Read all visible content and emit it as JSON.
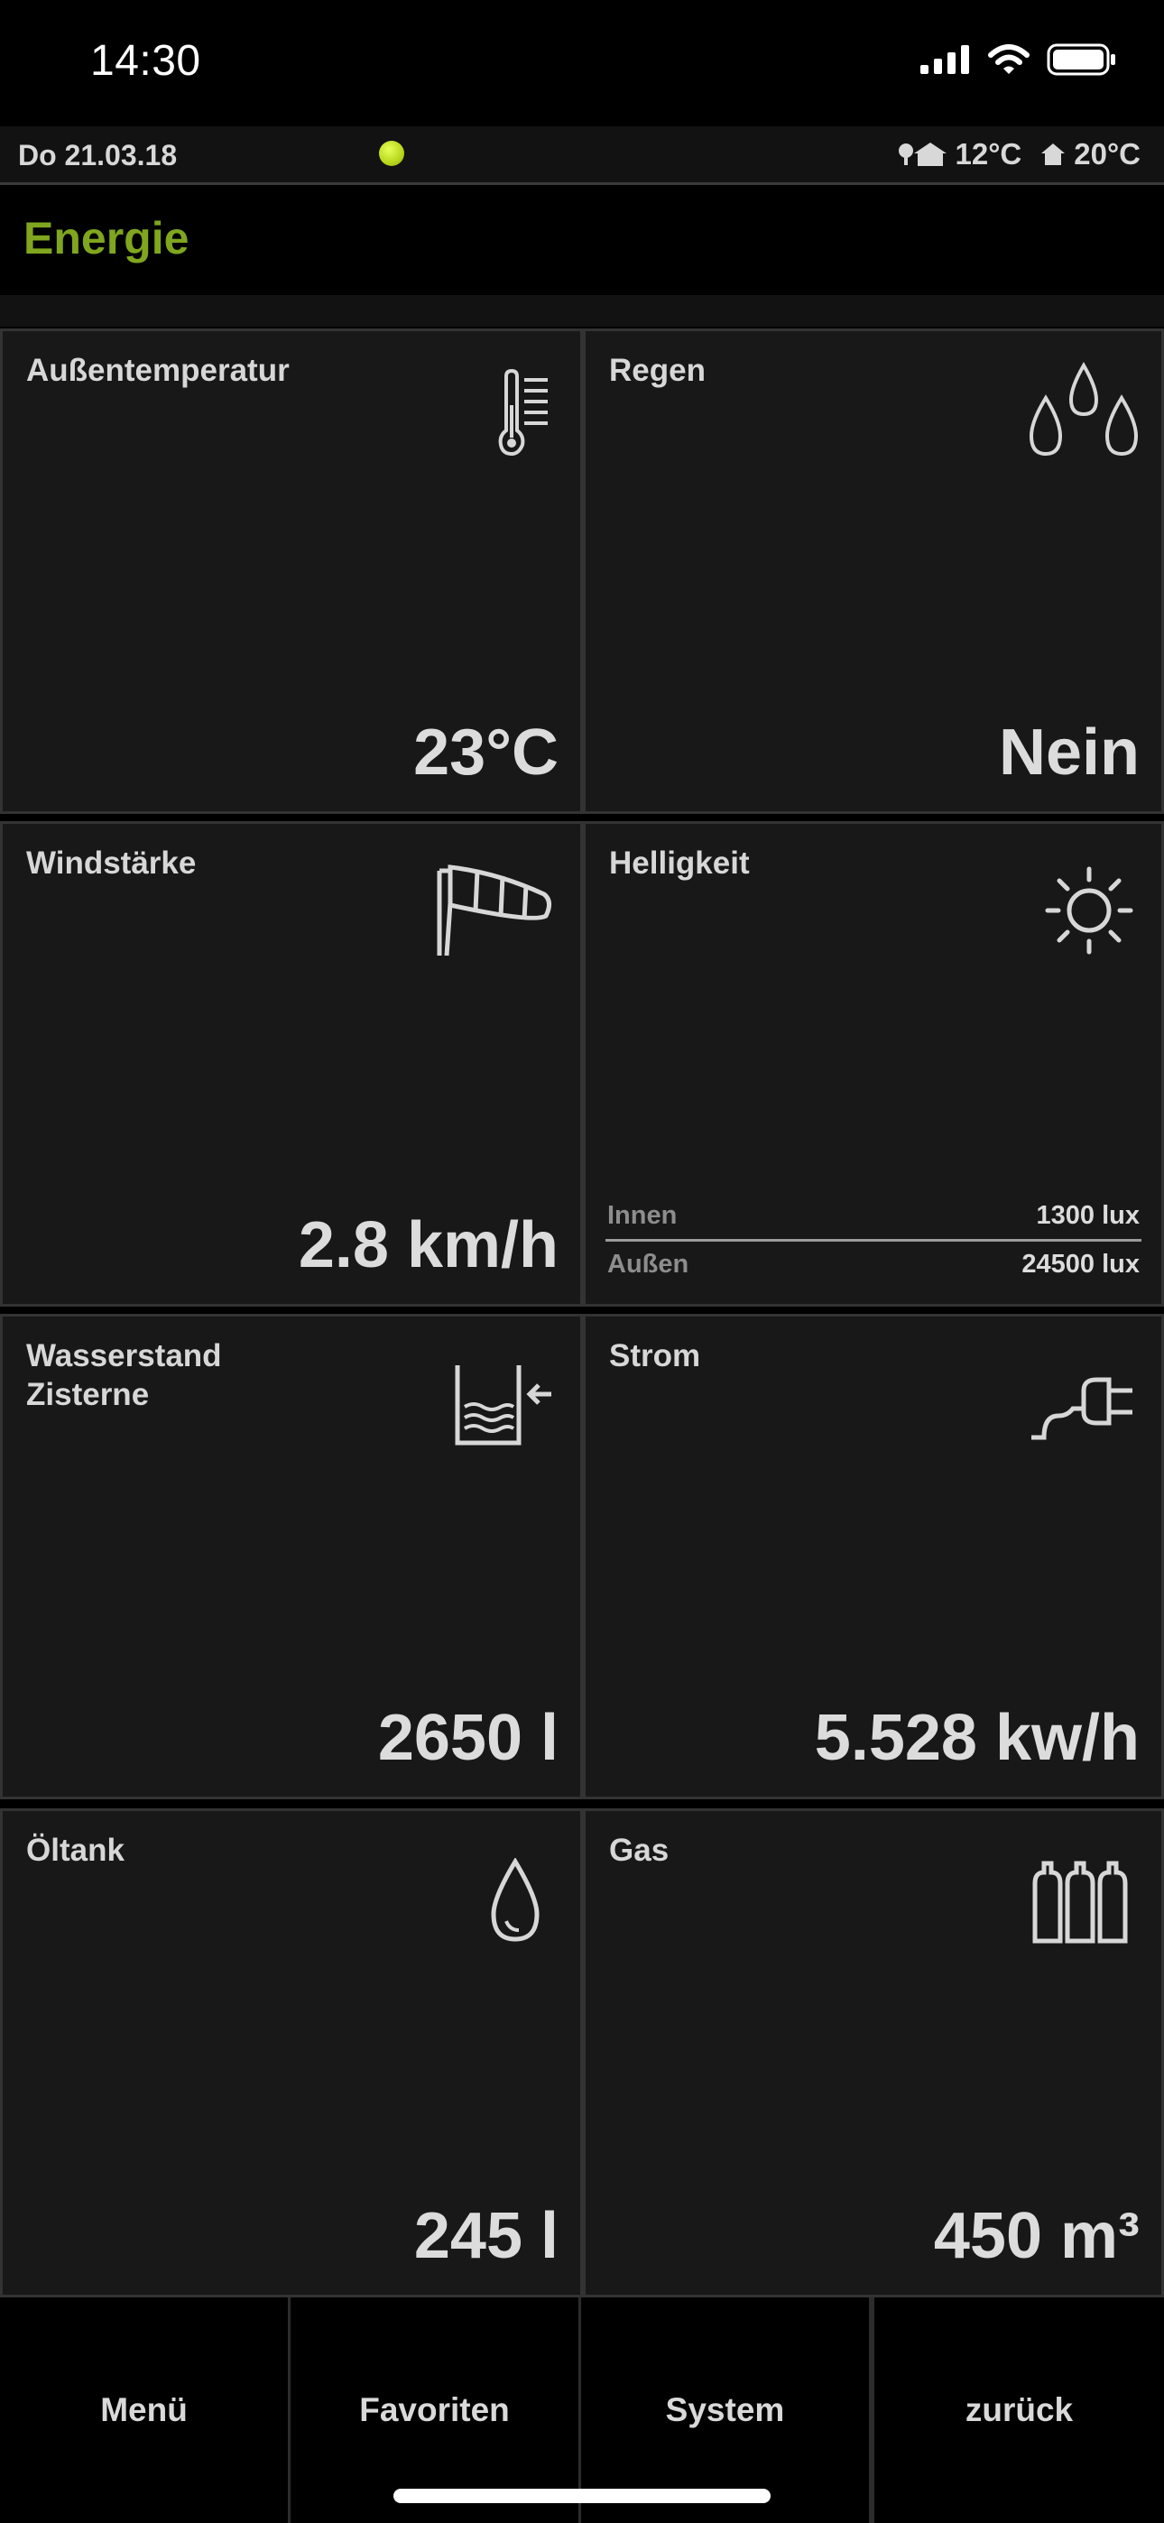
{
  "status_bar": {
    "time": "14:30"
  },
  "header": {
    "date": "Do 21.03.18",
    "outdoor_temp": "12°C",
    "indoor_temp": "20°C",
    "status_dot_color": "#c8e62a"
  },
  "page": {
    "title": "Energie",
    "title_color": "#7fa61e"
  },
  "tiles": [
    {
      "label": "Außentemperatur",
      "value": "23°C",
      "icon": "thermometer-icon"
    },
    {
      "label": "Regen",
      "value": "Nein",
      "icon": "raindrops-icon"
    },
    {
      "label": "Windstärke",
      "value": "2.8 km/h",
      "icon": "windsock-icon"
    },
    {
      "label": "Helligkeit",
      "icon": "sun-icon",
      "rows": [
        {
          "k": "Innen",
          "v": "1300 lux"
        },
        {
          "k": "Außen",
          "v": "24500 lux"
        }
      ]
    },
    {
      "label_line1": "Wasserstand",
      "label_line2": "Zisterne",
      "value": "2650 l",
      "icon": "cistern-icon"
    },
    {
      "label": "Strom",
      "value": "5.528 kw/h",
      "icon": "power-plug-icon"
    },
    {
      "label": "Öltank",
      "value": "245 l",
      "icon": "drop-icon"
    },
    {
      "label": "Gas",
      "value": "450 m³",
      "icon": "gas-bottles-icon"
    }
  ],
  "bottom_nav": [
    {
      "label": "Menü"
    },
    {
      "label": "Favoriten"
    },
    {
      "label": "System"
    },
    {
      "label": "zurück"
    }
  ]
}
